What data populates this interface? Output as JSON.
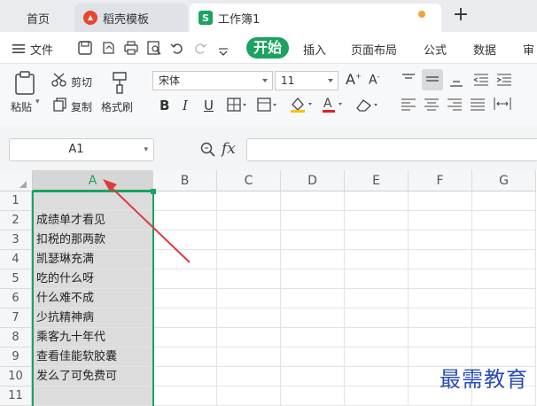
{
  "tabs": {
    "home": "首页",
    "template": "稻壳模板",
    "workbook": "工作簿1",
    "workbook_icon": "S"
  },
  "menu": {
    "file": "文件",
    "start": "开始",
    "insert": "插入",
    "layout": "页面布局",
    "formula": "公式",
    "data": "数据",
    "review_partial": "审"
  },
  "ribbon": {
    "paste": "粘贴",
    "cut": "剪切",
    "copy": "复制",
    "format_painter": "格式刷",
    "font_name": "宋体",
    "font_size": "11"
  },
  "formula_bar": {
    "name_box": "A1",
    "fx": "fx"
  },
  "grid": {
    "columns": [
      "A",
      "B",
      "C",
      "D",
      "E",
      "F",
      "G"
    ],
    "rows": [
      "1",
      "2",
      "3",
      "4",
      "5",
      "6",
      "7",
      "8",
      "9",
      "10",
      "11"
    ],
    "column_a_values": [
      "",
      "成绩单才看见",
      "扣税的那两款",
      "凯瑟琳充满",
      "吃的什么呀",
      "什么难不成",
      "少抗精神病",
      "乘客九十年代",
      "查看佳能软胶囊",
      "发么了可免费可",
      ""
    ]
  },
  "colors": {
    "accent": "#1ba360",
    "arrow": "#e03a3a",
    "selection_fill": "#dcdcdc"
  },
  "watermark": "最需教育"
}
